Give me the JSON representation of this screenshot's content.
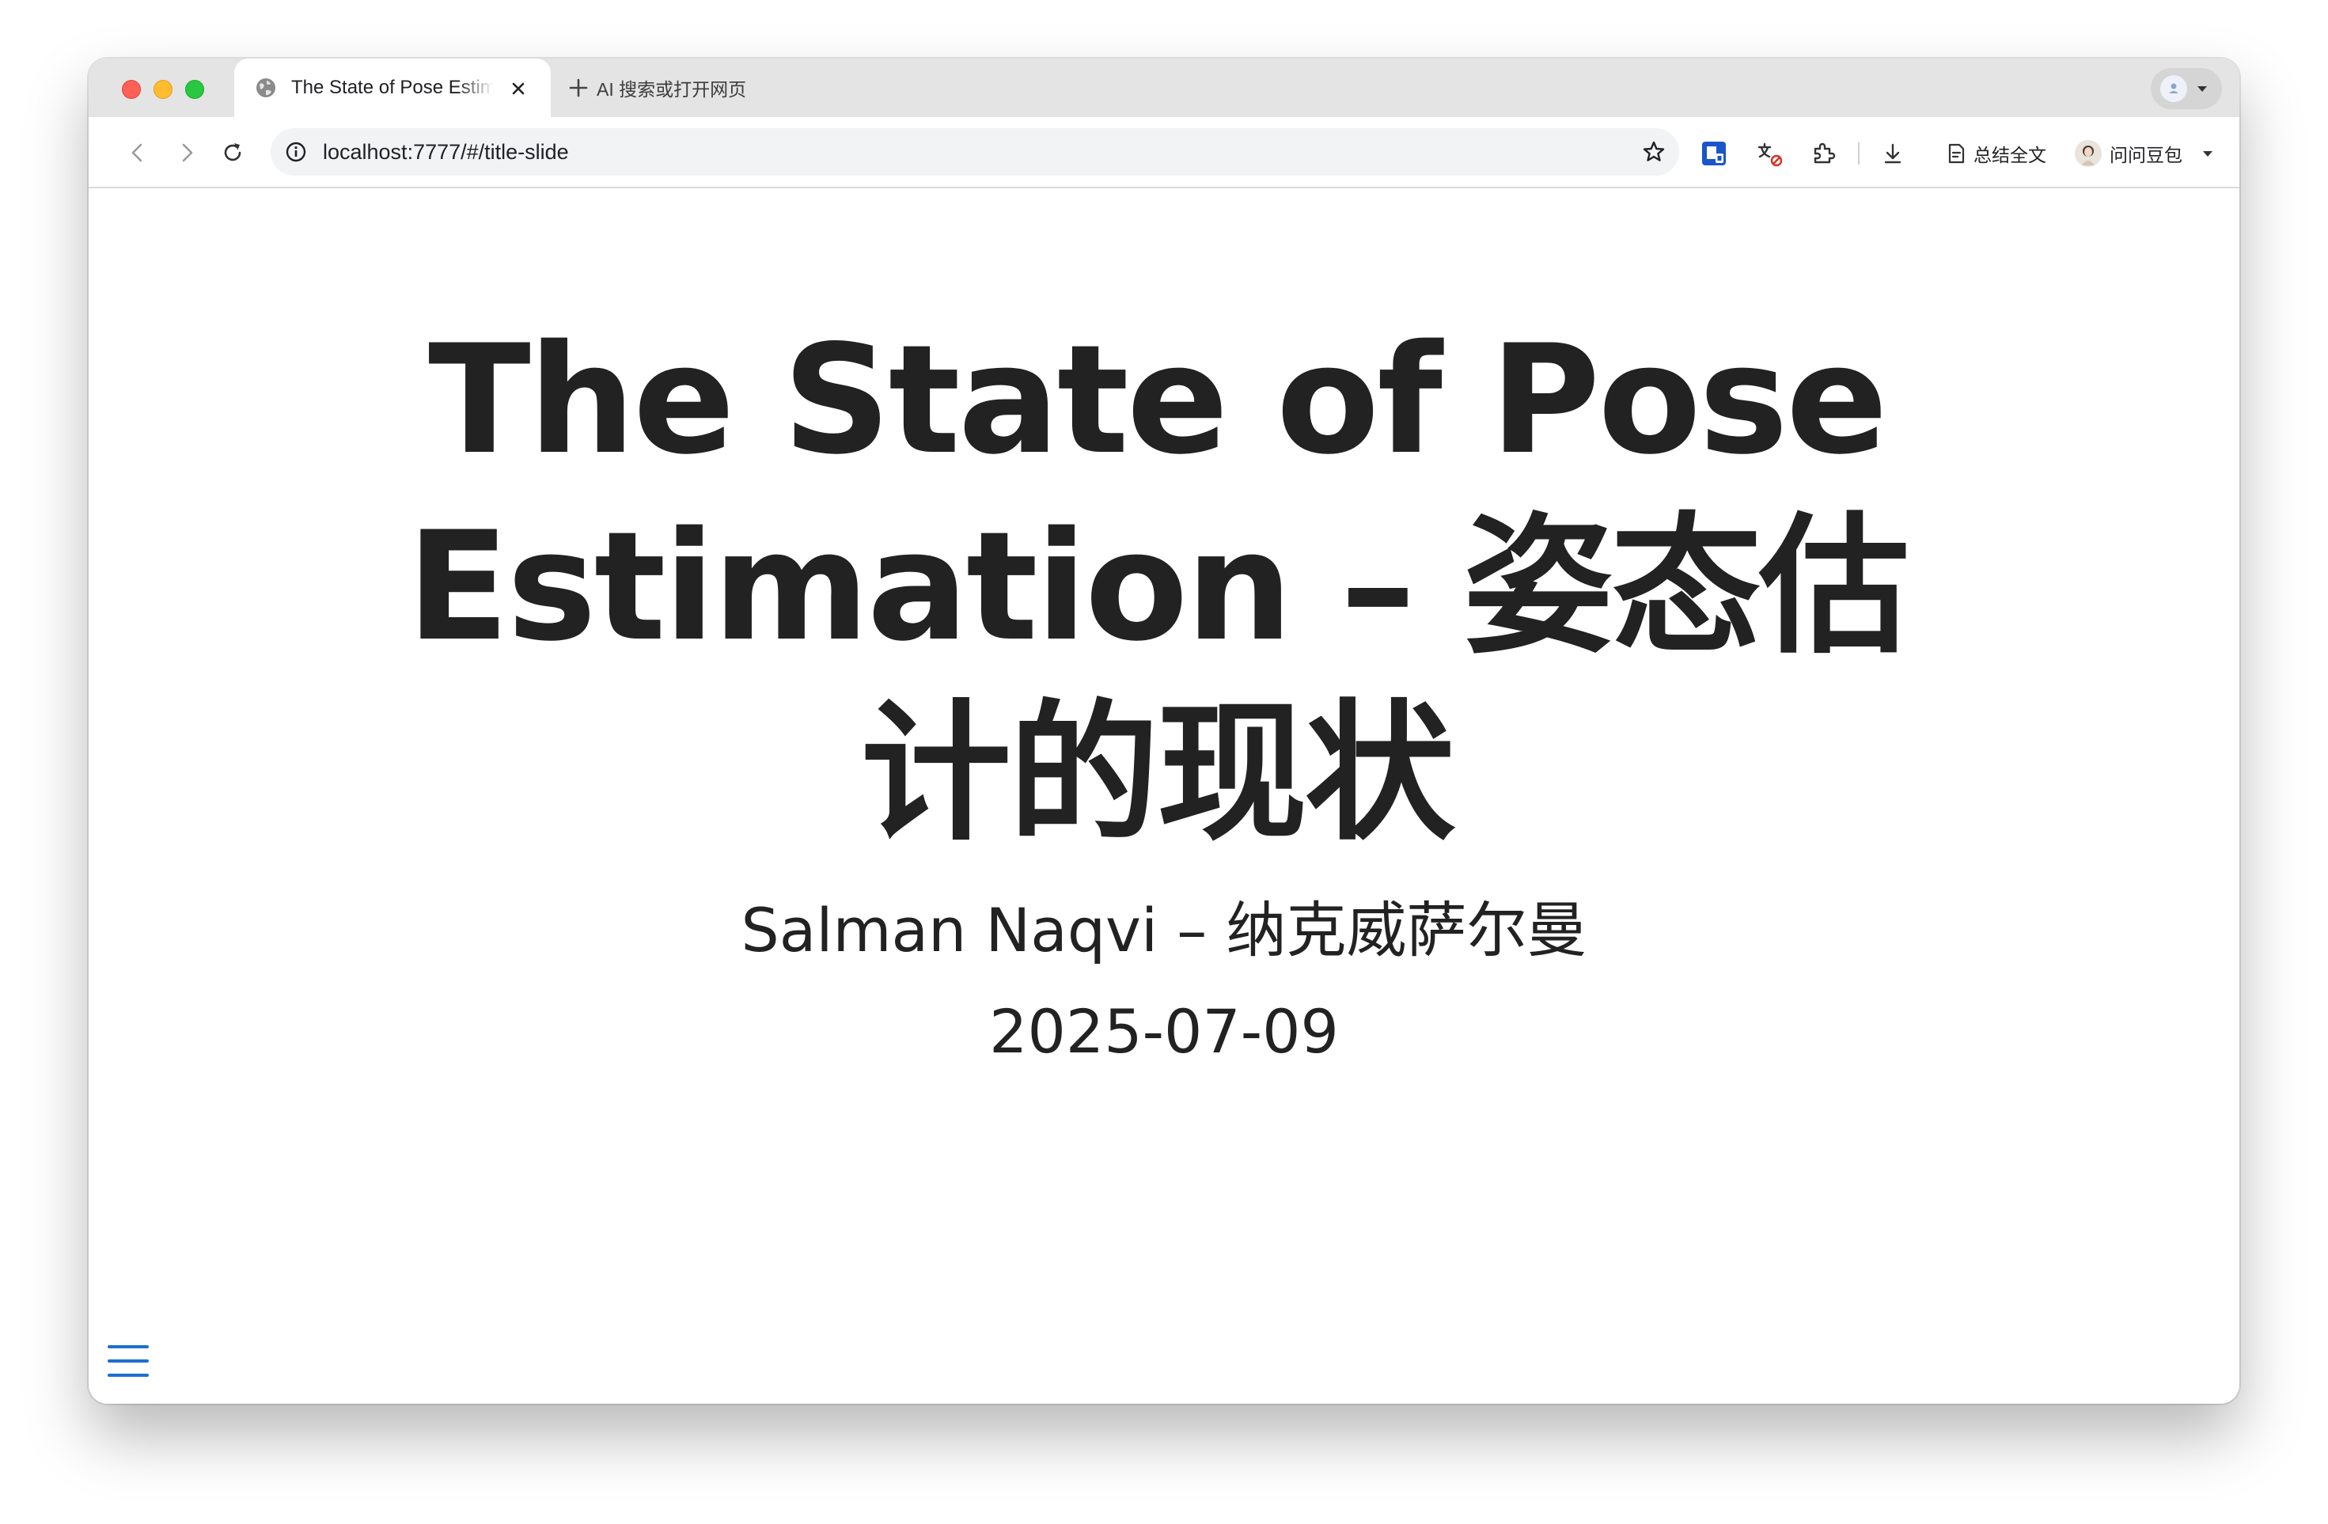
{
  "browser": {
    "tab": {
      "title": "The State of Pose Estimation – 姿态估计的现状",
      "favicon": "globe-icon",
      "close_icon": "close-icon"
    },
    "new_tab_label": "AI 搜索或打开网页",
    "address": {
      "url": "localhost:7777/#/title-slide"
    },
    "toolbar": {
      "summary_label": "总结全文",
      "ask_label": "问问豆包"
    },
    "colors": {
      "tab_strip": "#e4e4e4",
      "accent": "#1e6fcf"
    }
  },
  "slide": {
    "title": "The State of Pose Estimation – 姿态估计的现状",
    "author": "Salman Naqvi – 纳克威萨尔曼",
    "date": "2025-07-09",
    "text_color": "#222222"
  },
  "menu": {
    "icon": "hamburger-menu-icon"
  }
}
